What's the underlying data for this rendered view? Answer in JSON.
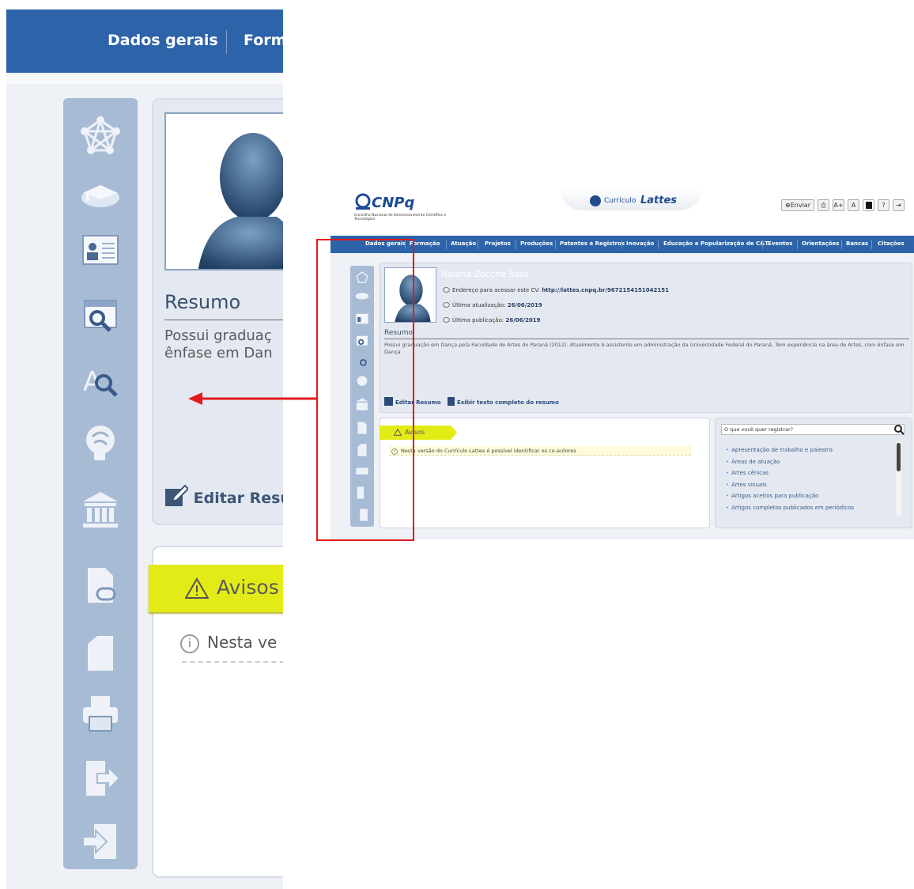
{
  "zoom": {
    "nav_items": [
      "Dados gerais",
      "Form"
    ],
    "resumo_title": "Resumo",
    "resumo_lines": [
      "Possui graduaç",
      "ênfase em Dan"
    ],
    "edit_label": "Editar Resu",
    "avisos_label": "Avisos",
    "nota_text": "Nesta ve"
  },
  "screenshot": {
    "logo": {
      "name": "CNPq",
      "subtitle": "Conselho Nacional de Desenvolvimento Científico e Tecnológico"
    },
    "lattes": {
      "prefix": "Currículo",
      "name": "Lattes"
    },
    "toolbar": {
      "send": "Enviar",
      "font_up": "A+",
      "font_down": "A",
      "help": "?"
    },
    "menu": [
      "Dados gerais",
      "Formação",
      "Atuação",
      "Projetos",
      "Produções",
      "Patentes e Registros",
      "Inovação",
      "Educação e Popularização de C&T",
      "Eventos",
      "Orientações",
      "Bancas",
      "Citações"
    ],
    "profile": {
      "name": "Naiana Zocche Sato",
      "address_label": "Endereço para acessar este CV:",
      "address_url": "http://lattes.cnpq.br/9672154151042151",
      "updated_label": "Última atualização:",
      "updated_date": "26/06/2019",
      "published_label": "Última publicação:",
      "published_date": "26/06/2019"
    },
    "resumo": {
      "title": "Resumo",
      "text": "Possui graduação em Dança pela Faculdade de Artes do Paraná (2012). Atualmente é assistente em administração da Universidade Federal do Paraná. Tem experiência na área de Artes, com ênfase em Dança",
      "edit_link": "Editar Resumo",
      "full_link": "Exibir texto completo do resumo"
    },
    "avisos": {
      "tab": "Avisos",
      "note": "Nesta versão do Currículo Lattes é possível identificar os co-autores"
    },
    "register": {
      "placeholder": "O que você quer registrar?",
      "items": [
        "Apresentação de trabalho e palestra",
        "Áreas de atuação",
        "Artes cênicas",
        "Artes visuais",
        "Artigos aceitos para publicação",
        "Artigos completos publicados em periódicos"
      ]
    }
  },
  "colors": {
    "nav_blue": "#2d63a8",
    "sidebar": "#a7bbd5",
    "panel": "#e4e9f1",
    "avisos_yellow": "#e3eb17",
    "highlight_red": "#e31a1c"
  },
  "icons": [
    "network-icon",
    "graduation-cap-icon",
    "id-card-icon",
    "calendar-search-icon",
    "text-search-icon",
    "brain-icon",
    "institution-icon",
    "document-link-icon",
    "document-icon",
    "printer-icon",
    "export-icon",
    "login-icon"
  ]
}
